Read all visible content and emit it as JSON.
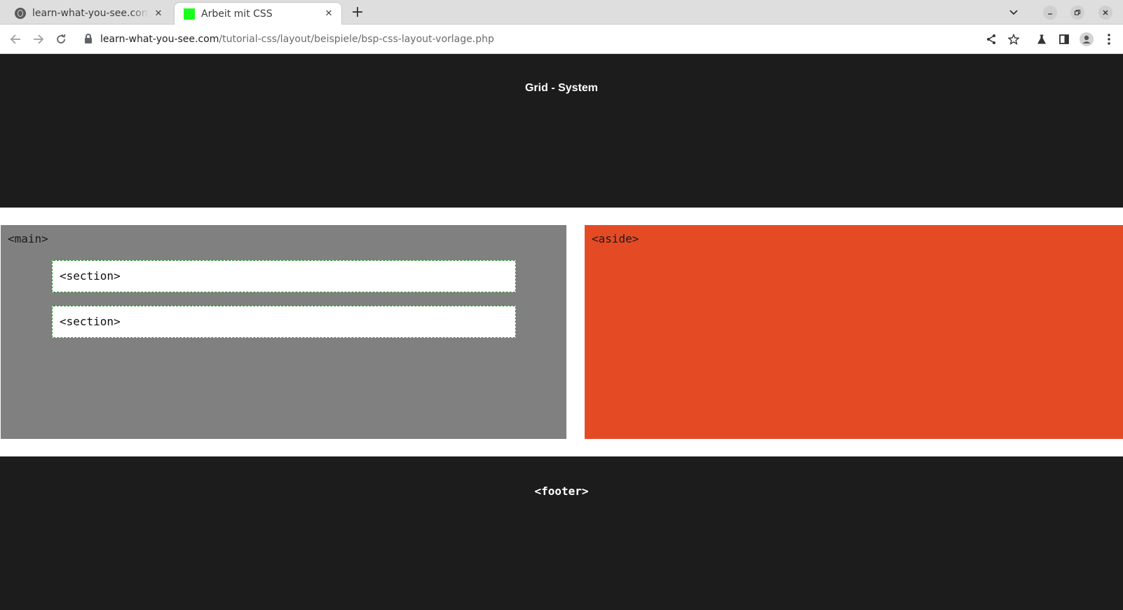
{
  "browser": {
    "tabs": [
      {
        "title": "learn-what-you-see.com",
        "active": false,
        "icon": "globe-icon"
      },
      {
        "title": "Arbeit mit CSS",
        "active": true,
        "icon": "green-square-icon",
        "icon_color": "#19ff1b"
      }
    ],
    "new_tab_label": "+",
    "address": {
      "host": "learn-what-you-see.com",
      "path": "/tutorial-css/layout/beispiele/bsp-css-layout-vorlage.php"
    }
  },
  "page": {
    "header_title": "Grid - System",
    "main_label": "<main>",
    "sections": [
      "<section>",
      "<section>"
    ],
    "aside_label": "<aside>",
    "footer_label": "<footer>",
    "colors": {
      "header_bg": "#1c1c1c",
      "main_bg": "#808080",
      "aside_bg": "#e44b25",
      "section_bg": "#ffffff",
      "section_border": "#1f8f1f",
      "footer_bg": "#1c1c1c"
    }
  }
}
